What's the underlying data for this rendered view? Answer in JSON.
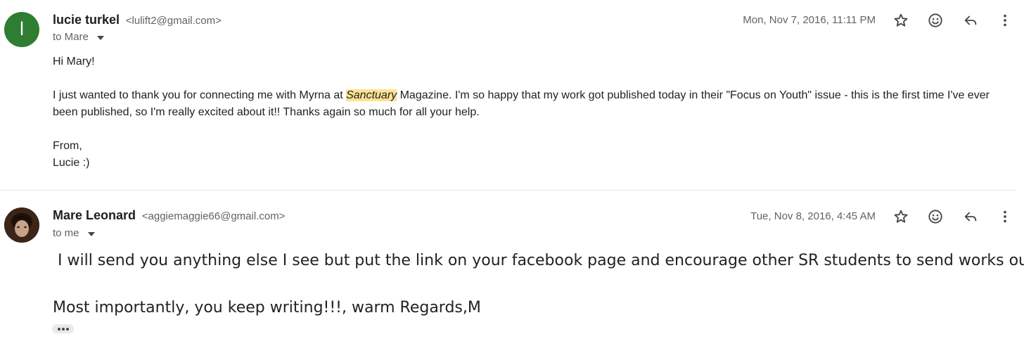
{
  "messages": [
    {
      "avatar_letter": "l",
      "avatar_color": "#2e7d32",
      "sender_name": "lucie turkel",
      "sender_email": "<lulift2@gmail.com>",
      "to": "to Mare",
      "date": "Mon, Nov 7, 2016, 11:11 PM",
      "body": {
        "greeting": "Hi Mary!",
        "p1_a": "I just wanted to thank you for connecting me with Myrna at ",
        "p1_highlight": "Sanctuary",
        "p1_b": " Magazine. I'm so happy that my work got published today in their \"Focus on Youth\" issue - this is the first time I've ever",
        "p1_c": "been published, so I'm really excited about it!! Thanks again so much for all your help.",
        "signoff": "From,",
        "signature": "Lucie :)"
      }
    },
    {
      "avatar_description": "profile-photo",
      "sender_name": "Mare Leonard",
      "sender_email": "<aggiemaggie66@gmail.com>",
      "to": "to me",
      "date": "Tue, Nov 8, 2016, 4:45 AM",
      "body": {
        "line1": " I will send you anything else I see but put the link on your facebook page and encourage other SR students to send works out.",
        "line2": "Most importantly, you keep writing!!!, warm Regards,M"
      }
    }
  ],
  "icons": [
    "star-icon",
    "emoji-icon",
    "reply-icon",
    "more-vert-icon",
    "ellipsis-icon",
    "caret-down-icon"
  ],
  "colors": {
    "highlight": "#fde293",
    "avatar_green": "#2e7d32"
  }
}
